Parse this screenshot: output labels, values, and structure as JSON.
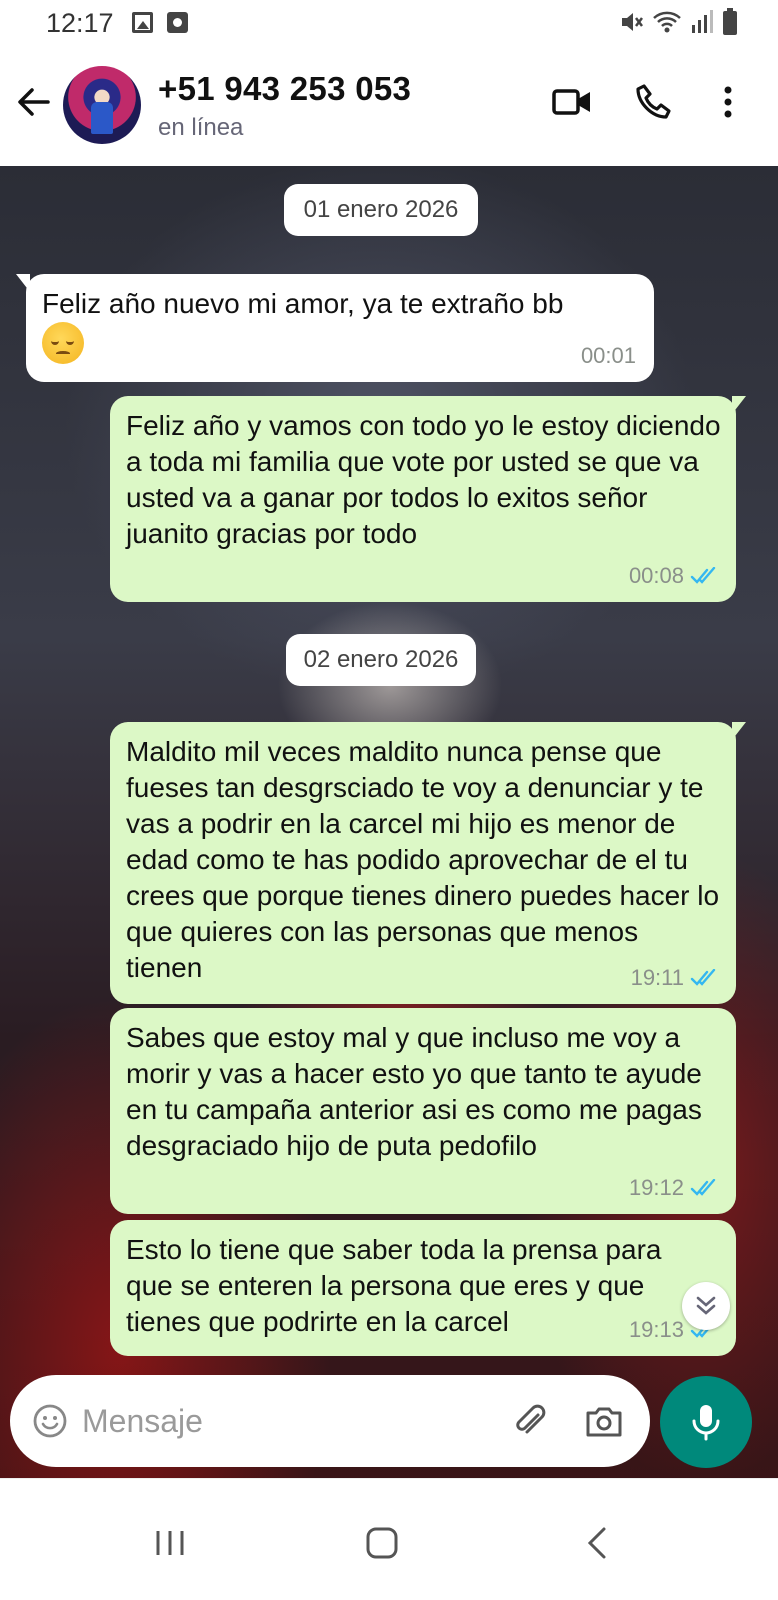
{
  "status_bar": {
    "time": "12:17"
  },
  "header": {
    "contact_name": "+51 943 253 053",
    "contact_status": "en línea"
  },
  "messages": [
    {
      "type": "date",
      "text": "01 enero 2026"
    },
    {
      "type": "in",
      "text": "Feliz año nuevo mi amor, ya te extraño bb",
      "emoji": "pensive-face",
      "time": "00:01"
    },
    {
      "type": "out",
      "text": "Feliz año y vamos con todo yo le estoy diciendo a toda mi familia que vote por usted se que va usted va a ganar por todos lo exitos señor juanito gracias por todo",
      "time": "00:08",
      "status": "read"
    },
    {
      "type": "date",
      "text": "02 enero 2026"
    },
    {
      "type": "out",
      "text": "Maldito mil veces maldito nunca pense que fueses tan desgrsciado te voy a denunciar y te vas a podrir en la carcel mi hijo es menor de edad como te has podido aprovechar de el tu crees que porque tienes dinero puedes hacer lo que quieres con las personas que menos tienen",
      "time": "19:11",
      "status": "read"
    },
    {
      "type": "out",
      "text": "Sabes que estoy mal y que incluso me voy a morir y vas a hacer esto yo que tanto te ayude en tu campaña anterior asi es como me pagas desgraciado hijo de puta pedofilo",
      "time": "19:12",
      "status": "read"
    },
    {
      "type": "out",
      "text": "Esto lo tiene que saber toda la prensa para que se enteren la persona que eres y que tienes que podrirte en la carcel",
      "time": "19:13",
      "status": "read"
    }
  ],
  "composer": {
    "placeholder": "Mensaje"
  },
  "colors": {
    "outgoing_bubble": "#dcf8c6",
    "incoming_bubble": "#ffffff",
    "read_ticks": "#34b7f1",
    "mic_button": "#00897b"
  },
  "icons": [
    "back-arrow-icon",
    "video-call-icon",
    "phone-icon",
    "more-vert-icon",
    "emoji-icon",
    "attach-icon",
    "camera-icon",
    "mic-icon",
    "scroll-down-icon",
    "recents-icon",
    "home-icon",
    "nav-back-icon"
  ]
}
